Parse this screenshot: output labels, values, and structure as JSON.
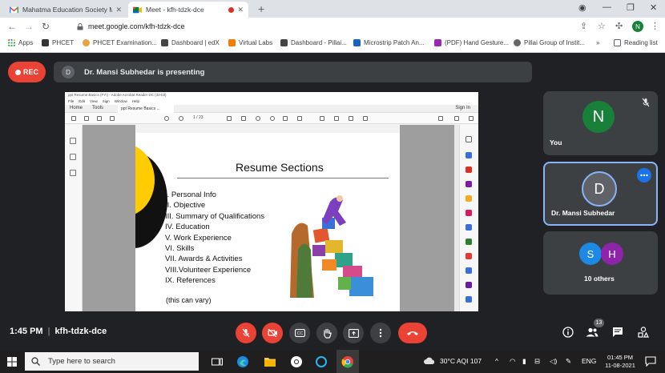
{
  "browser": {
    "tabs": [
      {
        "title": "Mahatma Education Society Mail",
        "active": false
      },
      {
        "title": "Meet - kfh-tdzk-dce",
        "active": true
      }
    ],
    "url": "meet.google.com/kfh-tdzk-dce",
    "profile_initial": "N",
    "bookmarks": [
      "Apps",
      "PHCET",
      "PHCET Examination...",
      "Dashboard | edX",
      "Virtual Labs",
      "Dashboard - Pillai...",
      "Microstrip Patch An...",
      "(PDF) Hand Gesture...",
      "Pillai Group of Instit...",
      "Reading list"
    ],
    "bookmarks_overflow": "»"
  },
  "meet": {
    "rec_label": "REC",
    "presenter_initial": "D",
    "presenting_text": "Dr. Mansi Subhedar is presenting",
    "meeting_time": "1:45 PM",
    "meeting_code": "kfh-tdzk-dce",
    "participant_count": "13",
    "participants": {
      "you": {
        "initial": "N",
        "name": "You"
      },
      "presenter": {
        "initial": "D",
        "name": "Dr. Mansi Subhedar"
      },
      "others": {
        "initials": [
          "S",
          "H"
        ],
        "label": "10 others"
      }
    }
  },
  "acrobat": {
    "window_title": "ppt Resume Basics (FYI) - Adobe Acrobat Reader DC (32-bit)",
    "menu": [
      "File",
      "Edit",
      "View",
      "Sign",
      "Window",
      "Help"
    ],
    "tabs": {
      "home": "Home",
      "tools": "Tools",
      "doc": "ppt Resume Basics ..."
    },
    "sign_in": "Sign In",
    "page_current": "1",
    "page_total": "/ 23"
  },
  "slide": {
    "title": "Resume Sections",
    "sections": [
      "I.    Personal Info",
      "II.   Objective",
      "III.  Summary of Qualifications",
      "IV.  Education",
      "V.    Work Experience",
      "VI.   Skills",
      "VII. Awards & Activities",
      "VIII.Volunteer Experience",
      "IX.  References"
    ],
    "note": "(this can vary)"
  },
  "taskbar": {
    "search_placeholder": "Type here to search",
    "weather": "30°C  AQI 107",
    "language": "ENG",
    "time": "01:45 PM",
    "date": "11-08-2021"
  }
}
